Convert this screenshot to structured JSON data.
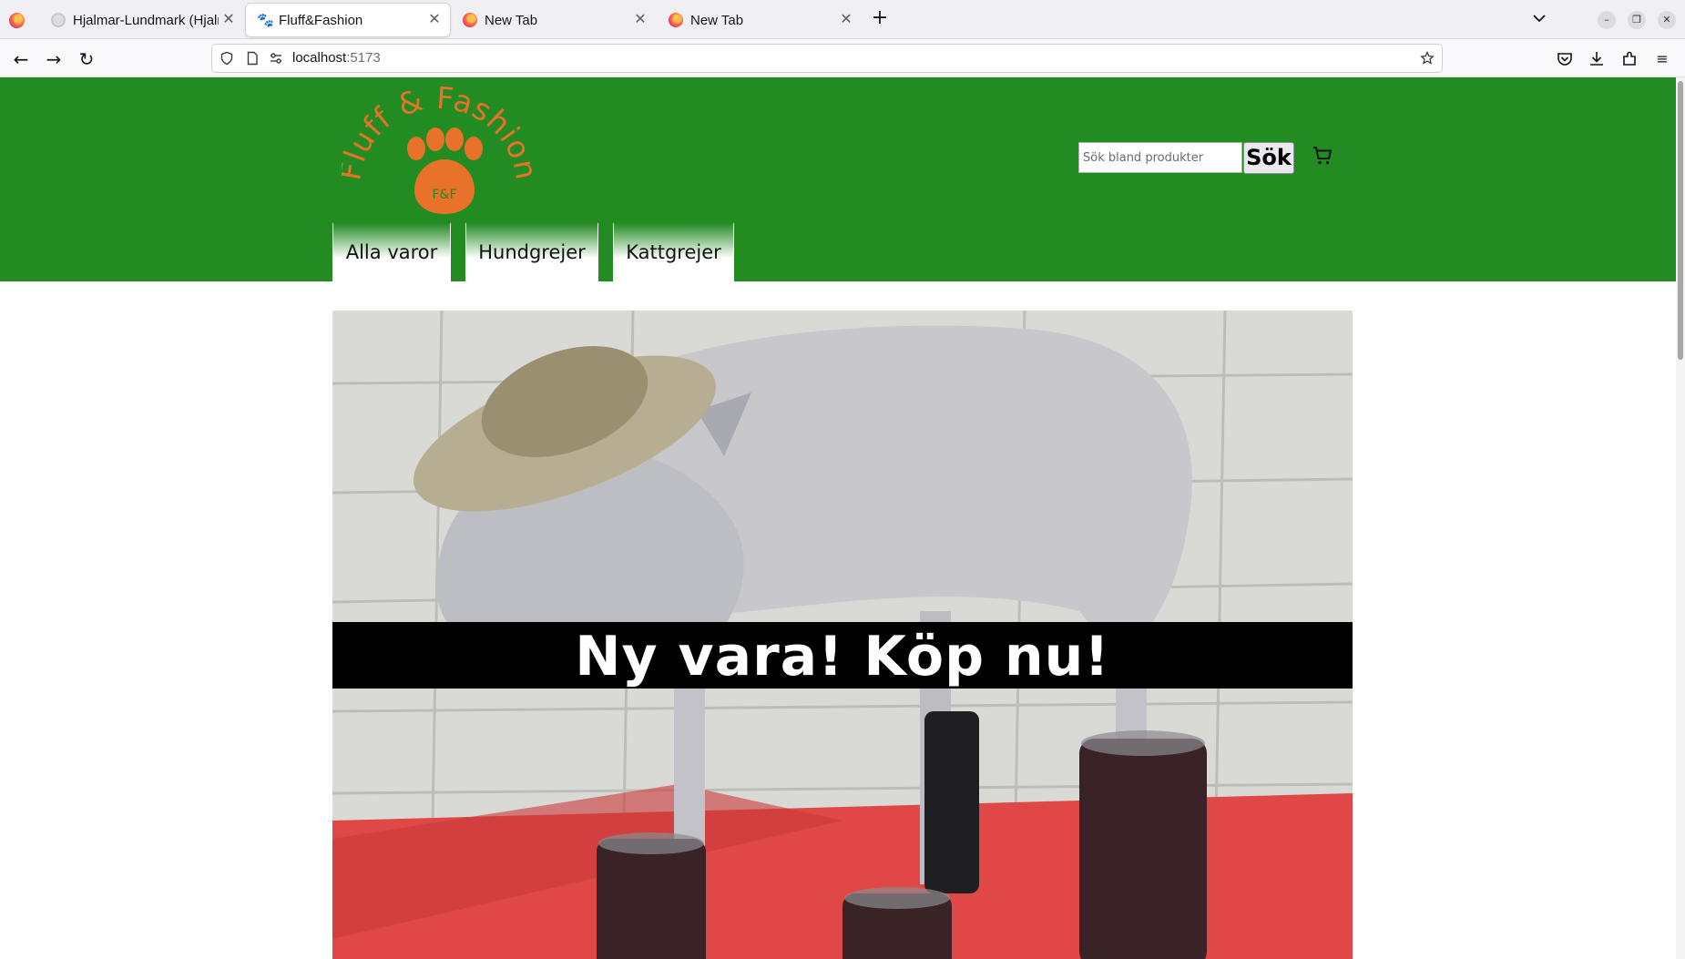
{
  "browser": {
    "tabs": [
      {
        "title": "Hjalmar-Lundmark (Hjalm",
        "favicon": "github-icon",
        "active": false
      },
      {
        "title": "Fluff&Fashion",
        "favicon": "paw-icon",
        "active": true
      },
      {
        "title": "New Tab",
        "favicon": "firefox-icon",
        "active": false
      },
      {
        "title": "New Tab",
        "favicon": "firefox-icon",
        "active": false
      }
    ],
    "url_host": "localhost",
    "url_port": ":5173"
  },
  "site": {
    "logo": {
      "text": "Fluff & Fashion",
      "monogram": "F&F"
    },
    "colors": {
      "header": "#228b22",
      "logo": "#e8722a",
      "banner": "#000000"
    },
    "search": {
      "placeholder": "Sök bland produkter",
      "button_label": "Sök"
    },
    "nav": [
      {
        "label": "Alla varor"
      },
      {
        "label": "Hundgrejer"
      },
      {
        "label": "Kattgrejer"
      }
    ],
    "hero": {
      "banner_text": "Ny vara! Köp nu!"
    }
  }
}
